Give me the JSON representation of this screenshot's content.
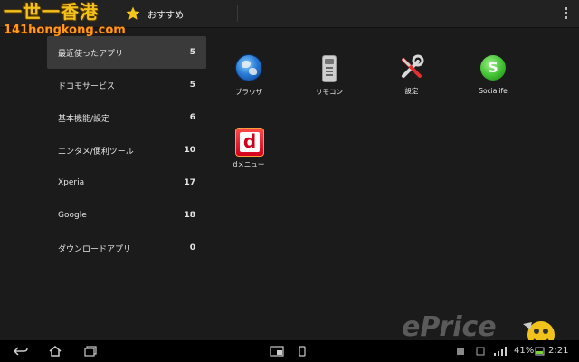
{
  "watermark": {
    "chinese": "一世一香港",
    "url": "141hongkong.com",
    "brand": "ePrice"
  },
  "header": {
    "title": "おすすめ"
  },
  "categories": [
    {
      "label": "最近使ったアプリ",
      "count": "5"
    },
    {
      "label": "ドコモサービス",
      "count": "5"
    },
    {
      "label": "基本機能/設定",
      "count": "6"
    },
    {
      "label": "エンタメ/便利ツール",
      "count": "10"
    },
    {
      "label": "Xperia",
      "count": "17"
    },
    {
      "label": "Google",
      "count": "18"
    },
    {
      "label": "ダウンロードアプリ",
      "count": "0"
    }
  ],
  "apps": [
    {
      "label": "ブラウザ",
      "icon": "browser-globe-icon"
    },
    {
      "label": "リモコン",
      "icon": "remote-control-icon"
    },
    {
      "label": "設定",
      "icon": "settings-tools-icon"
    },
    {
      "label": "Socialife",
      "icon": "socialife-icon"
    },
    {
      "label": "dメニュー",
      "icon": "dmenu-icon"
    }
  ],
  "status": {
    "battery": "41%",
    "time": "2:21"
  },
  "colors": {
    "accent_star": "#f5c518",
    "background": "#1b1b1b",
    "selected_row": "#3a3a3a"
  }
}
